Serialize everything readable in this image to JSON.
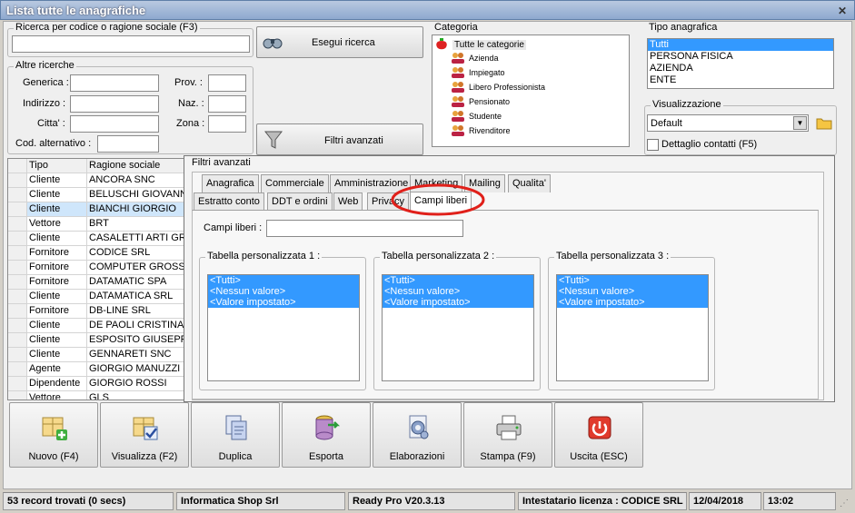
{
  "window": {
    "title": "Lista tutte le anagrafiche",
    "close": "✕"
  },
  "search": {
    "group_label": "Ricerca per codice o ragione sociale (F3)",
    "value": "",
    "button": "Esegui ricerca"
  },
  "other": {
    "group_label": "Altre ricerche",
    "generica": "Generica :",
    "indirizzo": "Indirizzo :",
    "citta": "Citta' :",
    "cod_alt": "Cod. alternativo :",
    "prov": "Prov. :",
    "naz": "Naz. :",
    "zona": "Zona :"
  },
  "filter_button": "Filtri avanzati",
  "categoria": {
    "label": "Categoria",
    "items": [
      "Tutte le categorie",
      "Azienda",
      "Impiegato",
      "Libero Professionista",
      "Pensionato",
      "Studente",
      "Rivenditore"
    ]
  },
  "tipo": {
    "label": "Tipo anagrafica",
    "items": [
      "Tutti",
      "PERSONA FISICA",
      "AZIENDA",
      "ENTE"
    ]
  },
  "visual": {
    "label": "Visualizzazione",
    "value": "Default",
    "dettaglio": "Dettaglio contatti (F5)"
  },
  "grid": {
    "headers": [
      "Tipo",
      "Ragione sociale"
    ],
    "rows": [
      [
        "Cliente",
        "ANCORA SNC"
      ],
      [
        "Cliente",
        "BELUSCHI GIOVANNI"
      ],
      [
        "Cliente",
        "BIANCHI GIORGIO"
      ],
      [
        "Vettore",
        "BRT"
      ],
      [
        "Cliente",
        "CASALETTI ARTI GRA"
      ],
      [
        "Fornitore",
        "CODICE SRL"
      ],
      [
        "Fornitore",
        "COMPUTER GROSS SP"
      ],
      [
        "Fornitore",
        "DATAMATIC SPA"
      ],
      [
        "Cliente",
        "DATAMATICA SRL"
      ],
      [
        "Fornitore",
        "DB-LINE SRL"
      ],
      [
        "Cliente",
        "DE PAOLI CRISTINA"
      ],
      [
        "Cliente",
        "ESPOSITO GIUSEPPE"
      ],
      [
        "Cliente",
        "GENNARETI SNC"
      ],
      [
        "Agente",
        "GIORGIO MANUZZI (C"
      ],
      [
        "Dipendente",
        "GIORGIO ROSSI"
      ],
      [
        "Vettore",
        "GLS"
      ]
    ]
  },
  "adv": {
    "title": "Filtri avanzati",
    "tabs_row1": [
      "Anagrafica",
      "Commerciale",
      "Amministrazione",
      "Marketing",
      "Mailing",
      "Qualita'"
    ],
    "tabs_row2": [
      "Estratto conto",
      "DDT e ordini",
      "Web",
      "Privacy",
      "Campi liberi"
    ],
    "campi_label": "Campi liberi :",
    "campi_value": "",
    "tables": [
      {
        "label": "Tabella personalizzata 1 :",
        "items": [
          "<Tutti>",
          "<Nessun valore>",
          "<Valore impostato>"
        ]
      },
      {
        "label": "Tabella personalizzata 2 :",
        "items": [
          "<Tutti>",
          "<Nessun valore>",
          "<Valore impostato>"
        ]
      },
      {
        "label": "Tabella personalizzata 3 :",
        "items": [
          "<Tutti>",
          "<Nessun valore>",
          "<Valore impostato>"
        ]
      }
    ]
  },
  "buttons": [
    "Nuovo (F4)",
    "Visualizza (F2)",
    "Duplica",
    "Esporta",
    "Elaborazioni",
    "Stampa (F9)",
    "Uscita (ESC)"
  ],
  "status": {
    "records": "53 record trovati (0 secs)",
    "company": "Informatica Shop Srl",
    "version": "Ready Pro V20.3.13",
    "license": "Intestatario licenza : CODICE SRL",
    "date": "12/04/2018",
    "time": "13:02"
  },
  "colors": {
    "selection": "#3399ff",
    "annotation": "#e0201a",
    "title_bar": "#8ea9cf"
  }
}
